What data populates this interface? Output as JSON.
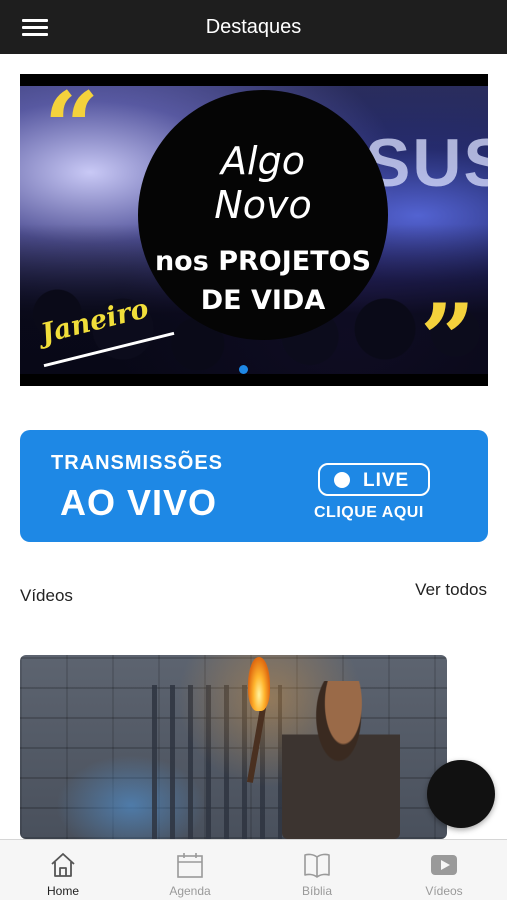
{
  "header": {
    "title": "Destaques",
    "menu_icon": "hamburger-menu-icon"
  },
  "banner": {
    "line1": "Algo",
    "line2": "Novo",
    "line3": "nos PROJETOS",
    "line4": "DE VIDA",
    "month": "Janeiro",
    "background_text": "SUS",
    "quote_open": "“",
    "quote_close": "”",
    "pager": {
      "current": 1,
      "total": 1
    }
  },
  "live": {
    "title_top": "TRANSMISSÕES",
    "title_main": "AO VIVO",
    "badge": "LIVE",
    "cta": "CLIQUE AQUI",
    "color": "#1e88e5"
  },
  "videos": {
    "section_title": "Vídeos",
    "see_all": "Ver todos"
  },
  "tabs": [
    {
      "label": "Home",
      "icon": "home-icon",
      "active": true
    },
    {
      "label": "Agenda",
      "icon": "calendar-icon",
      "active": false
    },
    {
      "label": "Bíblia",
      "icon": "book-icon",
      "active": false
    },
    {
      "label": "Vídeos",
      "icon": "youtube-play-icon",
      "active": false
    }
  ],
  "colors": {
    "topbar": "#1e1e1e",
    "accent": "#1e88e5",
    "quote_yellow": "#f4d23c",
    "tab_inactive": "#9a9a9a"
  }
}
